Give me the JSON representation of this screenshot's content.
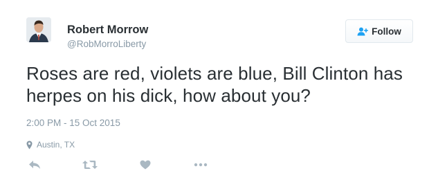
{
  "user": {
    "name": "Robert Morrow",
    "handle": "@RobMorroLiberty"
  },
  "follow_button": {
    "label": "Follow",
    "icon": "follow-user-icon"
  },
  "tweet": {
    "text": "Roses are red, violets are blue, Bill Clinton has herpes on his dick, how about you?",
    "timestamp": "2:00 PM - 15 Oct 2015",
    "location": "Austin, TX"
  },
  "actions": {
    "icons": [
      "reply-icon",
      "retweet-icon",
      "like-icon",
      "more-icon"
    ]
  },
  "colors": {
    "primary_text": "#292f33",
    "secondary_text": "#8899a6",
    "brand_blue": "#1da1f2",
    "icon_gray": "#aab8c2",
    "border": "#e1e8ed"
  }
}
